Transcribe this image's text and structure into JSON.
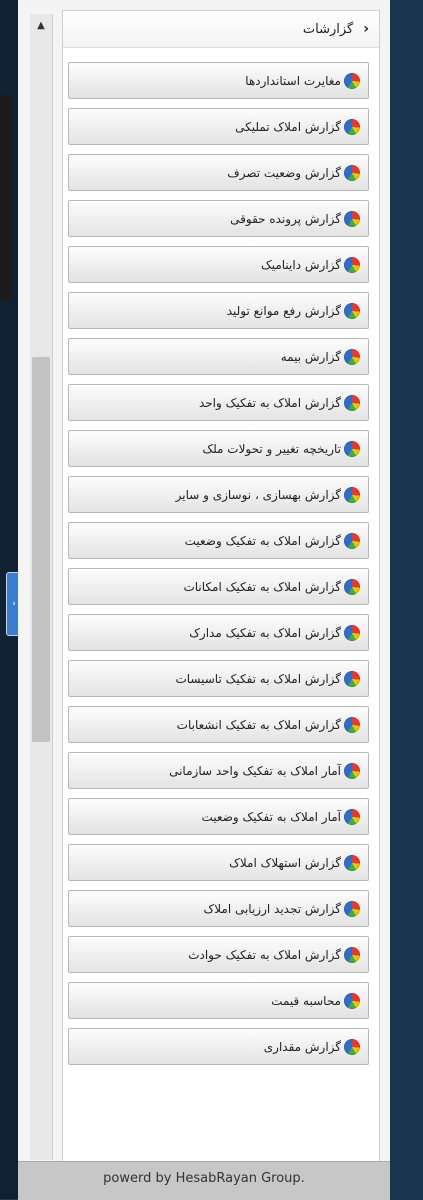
{
  "header": {
    "title": "گزارشات",
    "chevron_icon": "chevron-left-icon"
  },
  "items": [
    {
      "label": "مغایرت استانداردها"
    },
    {
      "label": "گزارش املاک تملیکی"
    },
    {
      "label": "گزارش وضعیت تصرف"
    },
    {
      "label": "گزارش پرونده حقوقی"
    },
    {
      "label": "گزارش داینامیک"
    },
    {
      "label": "گزارش رفع موانع تولید"
    },
    {
      "label": "گزارش بیمه"
    },
    {
      "label": "گزارش املاک به تفکیک واحد"
    },
    {
      "label": "تاریخچه تغییر و تحولات ملک"
    },
    {
      "label": "گزارش بهسازی ، نوسازی و سایر"
    },
    {
      "label": "گزارش املاک به تفکیک وضعیت"
    },
    {
      "label": "گزارش املاک به تفکیک امکانات"
    },
    {
      "label": "گزارش املاک به تفکیک مدارک"
    },
    {
      "label": "گزارش املاک به تفکیک تاسیسات"
    },
    {
      "label": "گزارش املاک به تفکیک انشعابات"
    },
    {
      "label": "آمار املاک به تفکیک واحد سازمانی"
    },
    {
      "label": "آمار املاک به تفکیک وضعیت"
    },
    {
      "label": "گزارش استهلاک املاک"
    },
    {
      "label": "گزارش تجدید ارزیابی املاک"
    },
    {
      "label": "گزارش املاک به تفکیک حوادث"
    },
    {
      "label": "محاسبه قیمت"
    },
    {
      "label": "گزارش مقداری"
    }
  ],
  "footer": {
    "text": "powerd by HesabRayan Group."
  },
  "icons": {
    "item_icon": "pie-chart-icon",
    "scroll_up": "arrow-up-icon"
  },
  "colors": {
    "pie_red": "#e53a2a",
    "pie_yellow": "#f2c200",
    "pie_green": "#3fae3a",
    "pie_blue": "#2a6fd0"
  }
}
